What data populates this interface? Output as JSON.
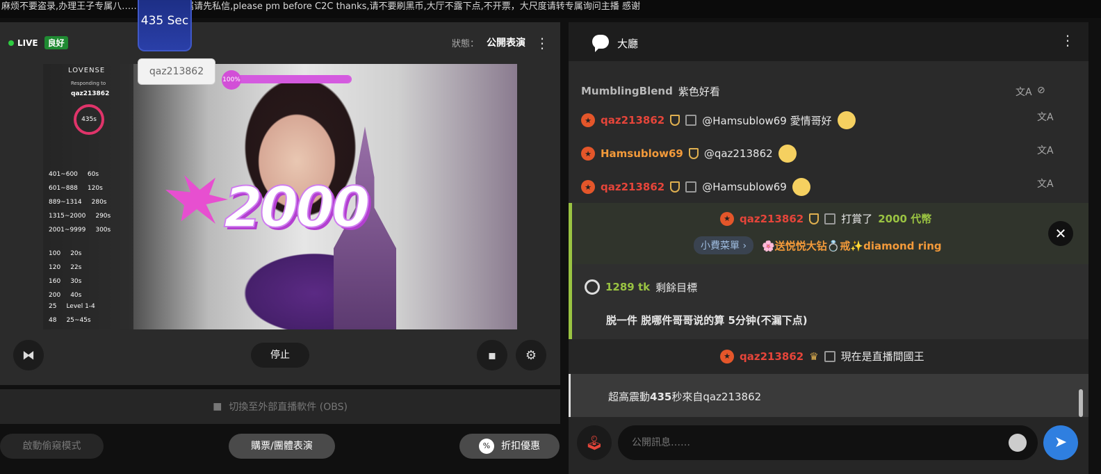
{
  "topic": "麻烦不要盗录,办理王子专属八…………所，专属请先私信,please pm before C2C thanks,请不要刷黑币,大厅不露下点,不开票，大尺度请转专属询问主播 感谢",
  "timer_badge": "435 Sec",
  "tip_username_popup": "qaz213862",
  "left": {
    "live_label": "LIVE",
    "quality_label": "良好",
    "status_label": "狀態：",
    "status_value": "公開表演",
    "overlay": {
      "brand": "LOVENSE",
      "responding_to": "Responding to",
      "user": "qaz213862",
      "ring_value": "435s",
      "rows": [
        {
          "a": "401~600",
          "b": "60s"
        },
        {
          "a": "601~888",
          "b": "120s"
        },
        {
          "a": "889~1314",
          "b": "280s"
        },
        {
          "a": "1315~2000",
          "b": "290s"
        },
        {
          "a": "2001~9999",
          "b": "300s"
        },
        {
          "a": "100",
          "b": "20s"
        },
        {
          "a": "120",
          "b": "22s"
        },
        {
          "a": "160",
          "b": "30s"
        },
        {
          "a": "200",
          "b": "40s"
        },
        {
          "a": "25",
          "b": "Level 1-4"
        },
        {
          "a": "48",
          "b": "25~45s"
        }
      ]
    },
    "progress": {
      "label": "100%",
      "value": 1.0
    },
    "gift_amount": "2000",
    "stop_label": "停止",
    "obs_label": "切換至外部直播軟件 (OBS)",
    "spy_mode_label": "啟動偷窺模式",
    "ticket_label": "購票/團體表演",
    "discount_label": "折扣優惠"
  },
  "right": {
    "title": "大廳",
    "messages": [
      {
        "user": "MumblingBlend",
        "text": "紫色好看"
      },
      {
        "user": "qaz213862",
        "text": "@Hamsublow69  愛情哥好"
      },
      {
        "user": "Hamsublow69",
        "text": "@qaz213862"
      },
      {
        "user": "qaz213862",
        "text": "@Hamsublow69"
      }
    ],
    "tip": {
      "user": "qaz213862",
      "action": "打賞了",
      "amount": "2000 代幣",
      "menu_label": "小費菜單",
      "menu_item": "🌸送悦悦大钻💍戒✨diamond ring"
    },
    "goal": {
      "tokens": "1289 tk",
      "label": "剩餘目標",
      "description": "脱一件 脱哪件哥哥说的算 5分钟(不漏下点)"
    },
    "king": {
      "user": "qaz213862",
      "text": "現在是直播間國王"
    },
    "vibe": {
      "prefix": "超高震動",
      "seconds": "435",
      "suffix": "秒來自qaz213862"
    },
    "input_placeholder": "公開訊息……"
  },
  "colors": {
    "accent_green": "#9ac342",
    "red_name": "#e6453a",
    "orange_name": "#f39a3a",
    "send_blue": "#2f7fe0"
  }
}
